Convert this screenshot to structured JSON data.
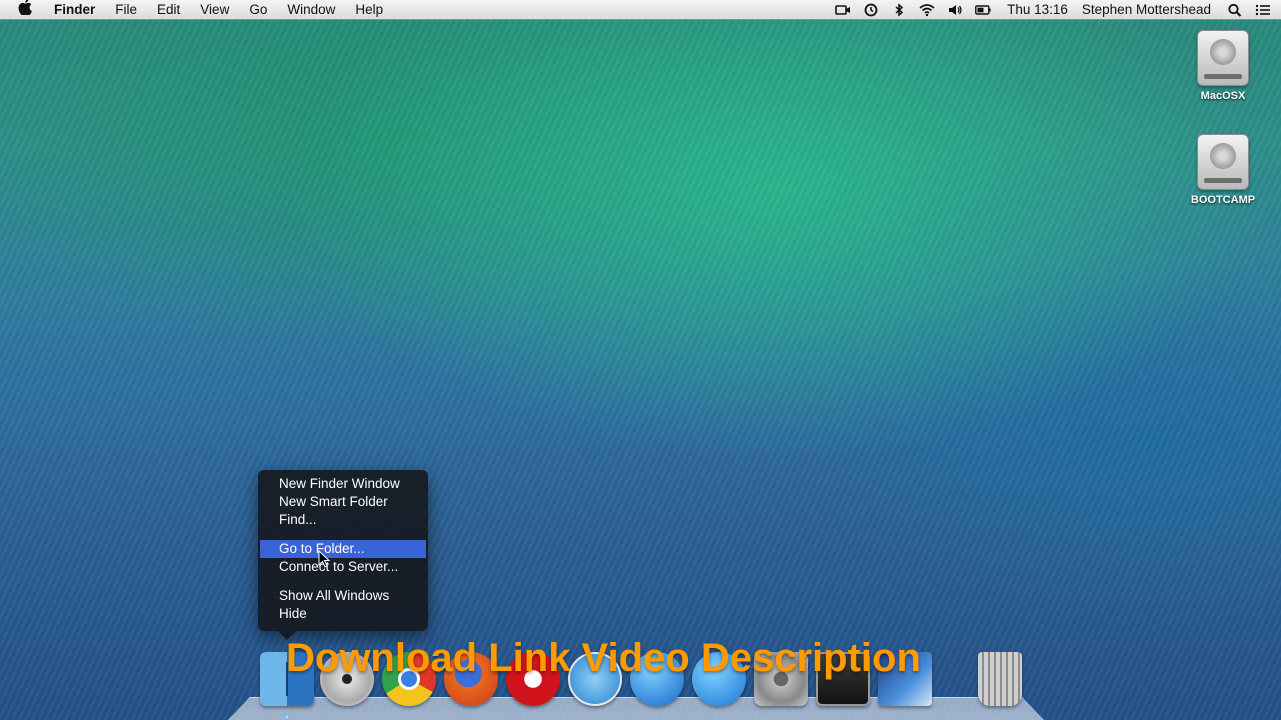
{
  "menubar": {
    "app_name": "Finder",
    "menus": [
      "File",
      "Edit",
      "View",
      "Go",
      "Window",
      "Help"
    ],
    "clock": "Thu 13:16",
    "user": "Stephen Mottershead",
    "status_icons": [
      "facetime-camera-icon",
      "time-machine-icon",
      "bluetooth-icon",
      "wifi-icon",
      "volume-icon",
      "battery-icon",
      "spotlight-icon",
      "notification-center-icon"
    ]
  },
  "desktop": {
    "drives": [
      {
        "label": "MacOSX",
        "icon": "hard-drive-icon"
      },
      {
        "label": "BOOTCAMP",
        "icon": "hard-drive-icon"
      }
    ]
  },
  "context_menu": {
    "items": [
      {
        "label": "New Finder Window"
      },
      {
        "label": "New Smart Folder"
      },
      {
        "label": "Find..."
      },
      {
        "label": "Go to Folder..."
      },
      {
        "label": "Connect to Server..."
      },
      {
        "label": "Show All Windows"
      },
      {
        "label": "Hide"
      }
    ],
    "selected": "Go to Folder..."
  },
  "dock": {
    "apps": [
      "finder-icon",
      "dvd-player-icon",
      "chrome-icon",
      "firefox-icon",
      "opera-icon",
      "safari-icon",
      "itunes-icon",
      "app-store-icon",
      "system-preferences-icon",
      "terminal-icon",
      "preview-icon",
      "trash-icon"
    ]
  },
  "overlay": {
    "text": "Download Link Video Description",
    "color": "#ff9b00"
  }
}
